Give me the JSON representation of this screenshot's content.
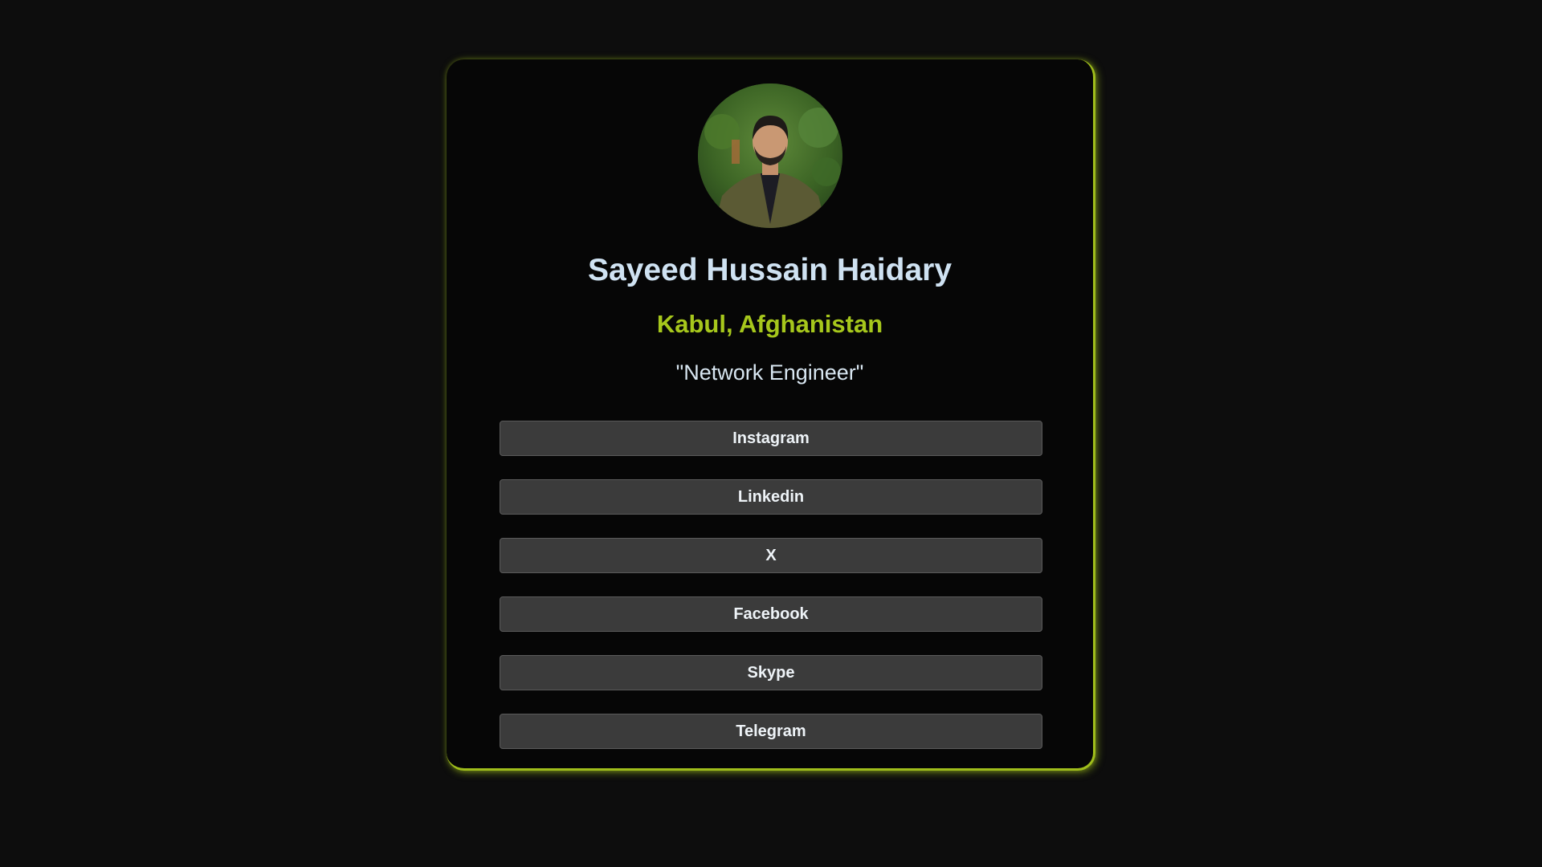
{
  "profile": {
    "name": "Sayeed Hussain Haidary",
    "location": "Kabul, Afghanistan",
    "tagline": "\"Network Engineer\"",
    "avatar_icon": "profile-photo"
  },
  "links": [
    {
      "label": "Instagram"
    },
    {
      "label": "Linkedin"
    },
    {
      "label": "X"
    },
    {
      "label": "Facebook"
    },
    {
      "label": "Skype"
    },
    {
      "label": "Telegram"
    }
  ],
  "colors": {
    "background": "#0d0d0d",
    "card": "#060606",
    "accent": "#a6c71c",
    "name_text": "#cfe2f2",
    "button_bg": "#3b3b3b"
  }
}
